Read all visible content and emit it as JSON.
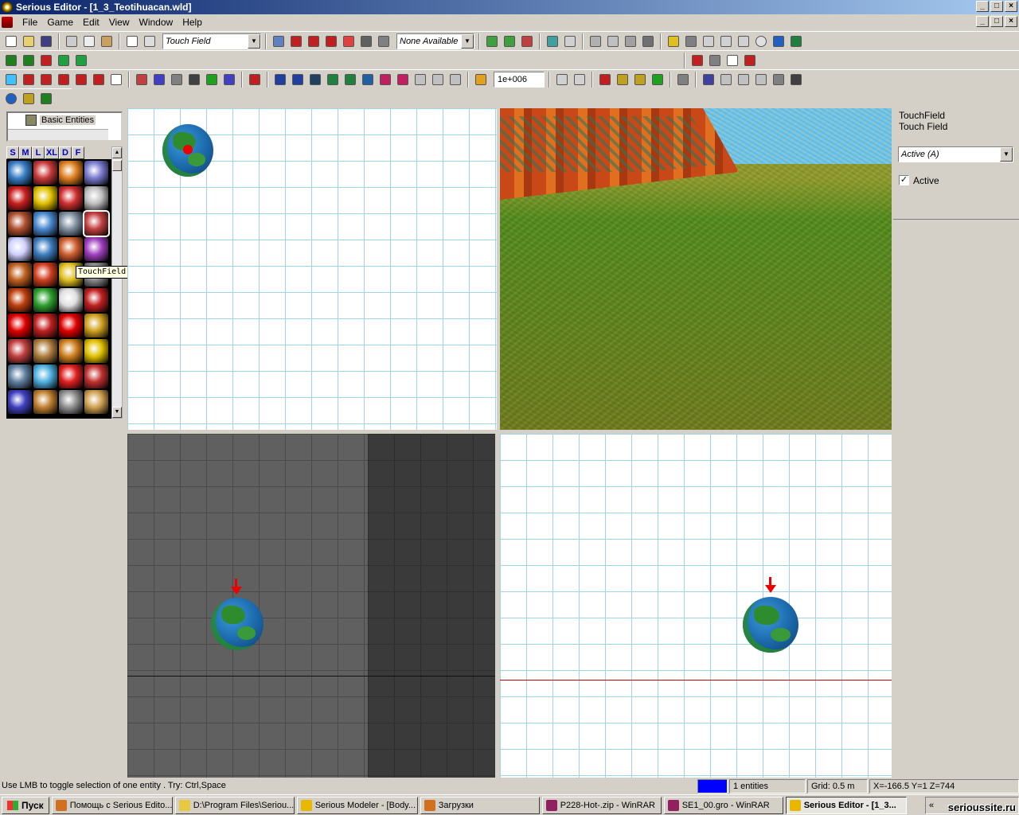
{
  "window": {
    "title": "Serious Editor - [1_3_Teotihuacan.wld]",
    "buttons": [
      "_",
      "□",
      "×"
    ]
  },
  "menu": {
    "items": [
      "File",
      "Game",
      "Edit",
      "View",
      "Window",
      "Help"
    ]
  },
  "toolbar": {
    "entity_combo": "Touch Field",
    "target_combo": "None Available",
    "number_field": "1e+006"
  },
  "left_panel": {
    "tree_item": "Basic Entities",
    "tabs": [
      "S",
      "M",
      "L",
      "XL",
      "D",
      "F"
    ],
    "tooltip": "TouchField",
    "palette_colors": [
      "#3a7fc8",
      "#c83a3a",
      "#e08020",
      "#7a7ad0",
      "#c82020",
      "#e0c000",
      "#d03030",
      "#c0c0c0",
      "#b05030",
      "#4a8ad0",
      "#8090a0",
      "#c04040",
      "#d0d0ff",
      "#4080c0",
      "#d06030",
      "#a040c0",
      "#c06020",
      "#d04020",
      "#e0c020",
      "#8a8a8a",
      "#c04010",
      "#30a030",
      "#e0e0e0",
      "#c02020",
      "#e00000",
      "#c02020",
      "#e00000",
      "#d0a020",
      "#c04040",
      "#b08040",
      "#d08020",
      "#e0c000",
      "#6080a0",
      "#50b0e0",
      "#e02020",
      "#c03030",
      "#4040c0",
      "#c08030",
      "#909090",
      "#d0a050"
    ]
  },
  "properties": {
    "class": "TouchField",
    "name": "Touch Field",
    "state_combo": "Active (A)",
    "checkbox_label": "Active",
    "checkbox_checked": true
  },
  "status": {
    "hint": "Use LMB to toggle selection of one entity . Try: Ctrl,Space",
    "entities": "1 entities",
    "grid": "Grid: 0.5 m",
    "coords": "X=-166.5 Y=1 Z=744"
  },
  "taskbar": {
    "start": "Пуск",
    "tasks": [
      {
        "label": "Помощь с Serious Edito...",
        "color": "#d07020"
      },
      {
        "label": "D:\\Program Files\\Seriou...",
        "color": "#e8c840"
      },
      {
        "label": "Serious Modeler - [Body...",
        "color": "#e8b800"
      },
      {
        "label": "Загрузки",
        "color": "#d07020"
      },
      {
        "label": "P228-Hot-.zip - WinRAR",
        "color": "#902060"
      },
      {
        "label": "SE1_00.gro - WinRAR",
        "color": "#902060"
      },
      {
        "label": "Serious Editor - [1_3...",
        "color": "#e8b800"
      }
    ],
    "tray_watermark": "serioussite.ru"
  },
  "colors": {
    "status_swatch": "#0000ff",
    "red_axis": "#c00000",
    "title_gradient_start": "#0a246a"
  }
}
